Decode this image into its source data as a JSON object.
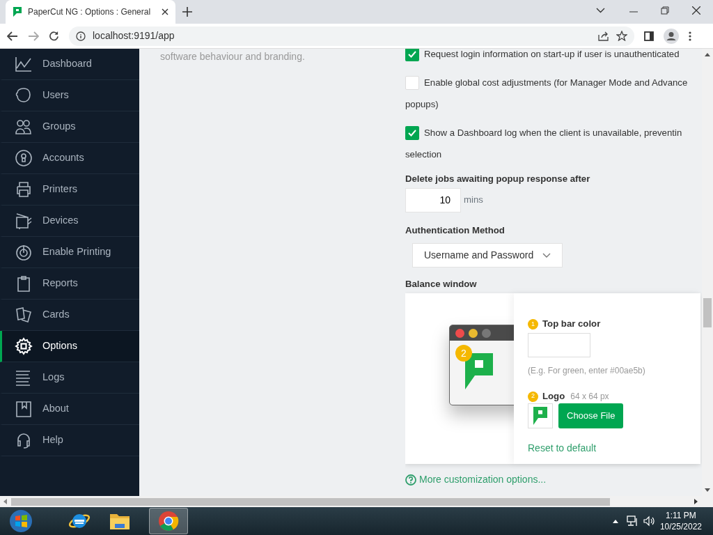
{
  "browser": {
    "tab_title": "PaperCut NG : Options : General",
    "url": "localhost:9191/app"
  },
  "sidebar": {
    "items": [
      {
        "label": "Dashboard",
        "selected": false
      },
      {
        "label": "Users",
        "selected": false
      },
      {
        "label": "Groups",
        "selected": false
      },
      {
        "label": "Accounts",
        "selected": false
      },
      {
        "label": "Printers",
        "selected": false
      },
      {
        "label": "Devices",
        "selected": false
      },
      {
        "label": "Enable Printing",
        "selected": false
      },
      {
        "label": "Reports",
        "selected": false
      },
      {
        "label": "Cards",
        "selected": false
      },
      {
        "label": "Options",
        "selected": true
      },
      {
        "label": "Logs",
        "selected": false
      },
      {
        "label": "About",
        "selected": false
      },
      {
        "label": "Help",
        "selected": false
      }
    ]
  },
  "intro": "software behaviour and branding.",
  "options": [
    {
      "label_lines": [
        "Request login information on start-up if user is unauthenticated"
      ],
      "checked": true
    },
    {
      "label_lines": [
        "Enable global cost adjustments (for Manager Mode and Advance",
        "popups)"
      ],
      "checked": false
    },
    {
      "label_lines": [
        "Show a Dashboard log when the client is unavailable, preventin",
        "selection"
      ],
      "checked": true
    }
  ],
  "delete_jobs": {
    "label": "Delete jobs awaiting popup response after",
    "value": "10",
    "unit": "mins"
  },
  "auth": {
    "label": "Authentication Method",
    "value": "Username and Password"
  },
  "balance_window": {
    "label": "Balance window",
    "preview_badge": "2",
    "top_bar": {
      "number": "1",
      "label": "Top bar color",
      "hint": "(E.g. For green, enter #00ae5b)"
    },
    "logo": {
      "number": "2",
      "label": "Logo",
      "size": "64 x 64 px",
      "button": "Choose File"
    },
    "reset": "Reset to default"
  },
  "more_link": "More customization options...",
  "taskbar": {
    "time": "1:11 PM",
    "date": "10/25/2022"
  }
}
